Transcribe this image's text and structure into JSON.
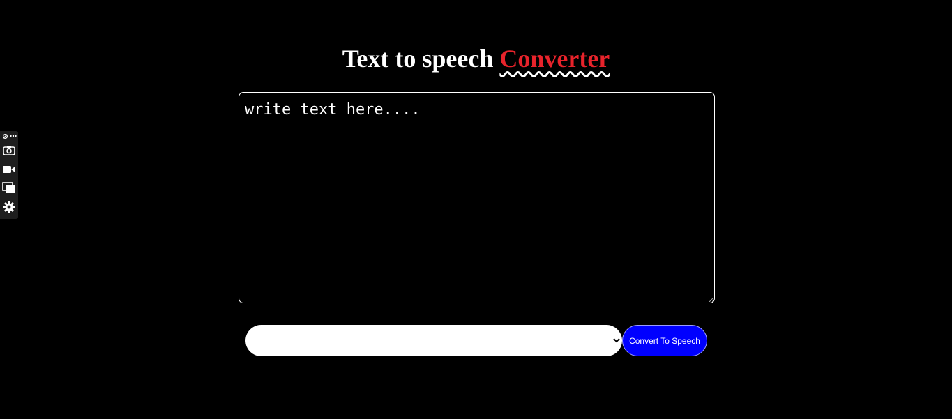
{
  "heading": {
    "main": "Text to speech ",
    "accent": "Converter"
  },
  "textarea": {
    "placeholder": "write text here....",
    "value": ""
  },
  "voice_select": {
    "selected": ""
  },
  "convert_button": {
    "label": "Convert To Speech"
  },
  "side_toolbar": {
    "icons": [
      "link-icon",
      "more-icon",
      "camera-icon",
      "video-icon",
      "windows-icon",
      "gear-icon"
    ]
  },
  "colors": {
    "background": "#000000",
    "heading": "#ffffff",
    "accent": "#e8232b",
    "button": "#0000ff",
    "toolbar": "#1e1e1e"
  }
}
